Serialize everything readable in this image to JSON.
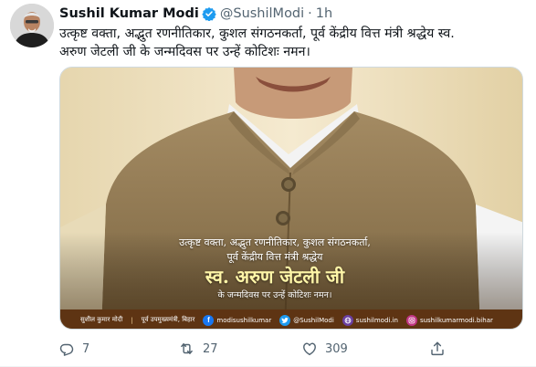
{
  "tweet": {
    "author_name": "Sushil Kumar Modi",
    "handle": "@SushilModi",
    "separator": "·",
    "time": "1h",
    "text_line1": "उत्कृष्ट वक्ता, अद्भुत रणनीतिकार, कुशल संगठनकर्ता,  पूर्व केंद्रीय वित्त मंत्री श्रद्धेय स्व.",
    "text_line2": "अरुण जेटली जी के जन्मदिवस पर उन्हें कोटिशः नमन।"
  },
  "poster": {
    "line1": "उत्कृष्ट वक्ता, अद्भुत रणनीतिकार, कुशल संगठनकर्ता,",
    "line2": "पूर्व केंद्रीय वित्त मंत्री श्रद्धेय",
    "line3": "स्व. अरुण जेटली जी",
    "line4": "के जन्मदिवस पर उन्हें कोटिशः नमन।",
    "footer": {
      "name": "सुशील कुमार मोदी",
      "separator": "|",
      "role": "पूर्व उपमुख्यमंत्री, बिहार",
      "facebook": "modisushilkumar",
      "twitter": "@SushilModi",
      "website": "sushilmodi.in",
      "instagram": "sushilkumarmodi.bihar"
    }
  },
  "actions": {
    "replies": "7",
    "retweets": "27",
    "likes": "309"
  },
  "colors": {
    "verified": "#1d9bf0",
    "secondary_text": "#536471",
    "footer_band": "#5e3413",
    "poster_background": "#f1e6c8"
  },
  "icons": [
    "verified-badge-icon",
    "reply-icon",
    "retweet-icon",
    "like-icon",
    "share-icon",
    "facebook-icon",
    "twitter-icon",
    "website-icon",
    "instagram-icon"
  ]
}
